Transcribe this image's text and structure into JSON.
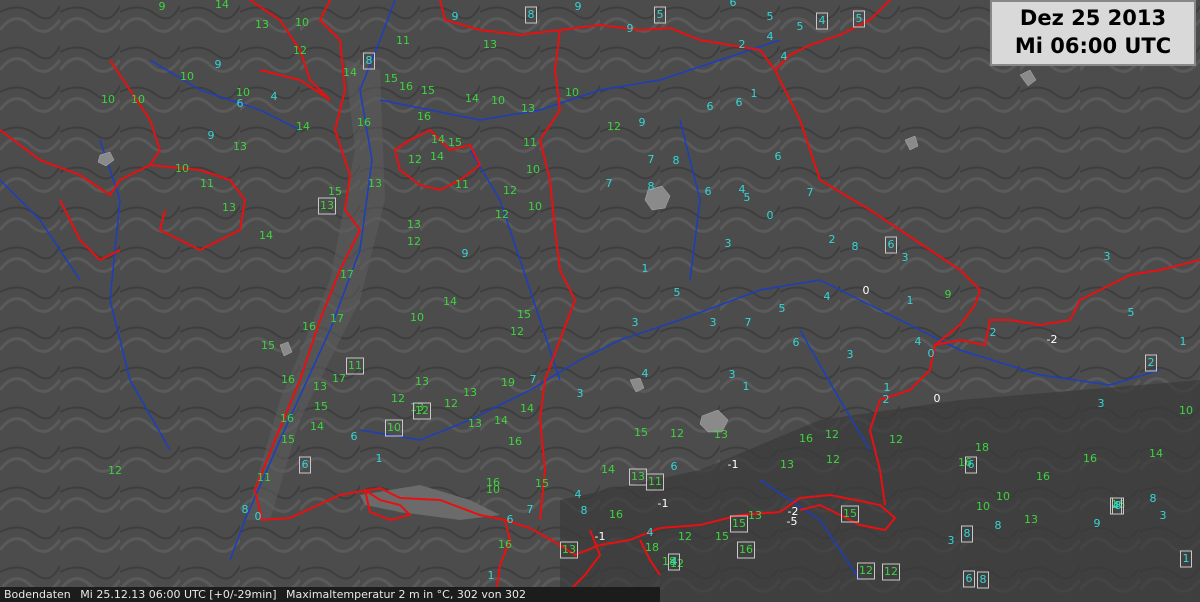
{
  "header": {
    "date": "Dez 25 2013",
    "time": "Mi 06:00 UTC"
  },
  "footer": {
    "source": "Bodendaten",
    "run": "Mi 25.12.13 06:00 UTC [+0/-29min]",
    "param": "Maximaltemperatur 2 m in °C, 302 von 302"
  },
  "colors": {
    "background": "#4a4a4a",
    "border": "#e81010",
    "river": "#1a3fbf",
    "warm": "#3fd43f",
    "mild": "#35d6d6",
    "cold": "#ffffff",
    "box": "#c8c8c8"
  },
  "stations": [
    {
      "t": "9",
      "c": "w"
    },
    {
      "t": "14",
      "c": "w"
    },
    {
      "t": "13",
      "c": "w"
    },
    {
      "t": "9",
      "c": "m"
    },
    {
      "t": "10",
      "c": "w"
    },
    {
      "t": "9",
      "c": "m"
    },
    {
      "t": "9",
      "c": "m"
    },
    {
      "t": "5",
      "c": "m"
    },
    {
      "t": "6",
      "c": "m"
    },
    {
      "t": "5",
      "c": "m"
    },
    {
      "t": "12",
      "c": "w"
    },
    {
      "t": "14",
      "c": "w"
    },
    {
      "t": "11",
      "c": "w"
    },
    {
      "t": "13",
      "c": "w"
    },
    {
      "t": "9",
      "c": "m"
    },
    {
      "t": "10",
      "c": "w"
    },
    {
      "t": "10",
      "c": "w"
    },
    {
      "t": "6",
      "c": "m"
    },
    {
      "t": "4",
      "c": "m"
    },
    {
      "t": "2",
      "c": "m"
    },
    {
      "t": "10",
      "c": "w"
    },
    {
      "t": "10",
      "c": "w"
    },
    {
      "t": "14",
      "c": "w"
    },
    {
      "t": "15",
      "c": "w"
    },
    {
      "t": "16",
      "c": "w"
    },
    {
      "t": "15",
      "c": "w"
    },
    {
      "t": "14",
      "c": "w"
    },
    {
      "t": "10",
      "c": "w"
    },
    {
      "t": "13",
      "c": "w"
    },
    {
      "t": "10",
      "c": "w"
    },
    {
      "t": "6",
      "c": "m"
    },
    {
      "t": "6",
      "c": "m"
    },
    {
      "t": "1",
      "c": "m"
    },
    {
      "t": "16",
      "c": "w"
    },
    {
      "t": "16",
      "c": "w"
    },
    {
      "t": "13",
      "c": "w"
    },
    {
      "t": "11",
      "c": "w"
    },
    {
      "t": "9",
      "c": "m"
    },
    {
      "t": "10",
      "c": "w"
    },
    {
      "t": "4",
      "c": "m"
    },
    {
      "t": "4",
      "c": "m"
    },
    {
      "t": "14",
      "c": "w"
    },
    {
      "t": "15",
      "c": "w"
    },
    {
      "t": "14",
      "c": "w"
    },
    {
      "t": "12",
      "c": "w"
    },
    {
      "t": "11",
      "c": "w"
    },
    {
      "t": "10",
      "c": "w"
    },
    {
      "t": "12",
      "c": "w"
    },
    {
      "t": "9",
      "c": "m"
    },
    {
      "t": "6",
      "c": "m"
    },
    {
      "t": "8",
      "c": "m"
    },
    {
      "t": "6",
      "c": "m"
    },
    {
      "t": "4",
      "c": "m"
    },
    {
      "t": "7",
      "c": "m"
    },
    {
      "t": "0",
      "c": "m"
    },
    {
      "t": "15",
      "c": "w"
    },
    {
      "t": "13",
      "c": "w"
    },
    {
      "t": "11",
      "c": "w"
    },
    {
      "t": "12",
      "c": "w"
    },
    {
      "t": "10",
      "c": "w"
    },
    {
      "t": "7",
      "c": "m"
    },
    {
      "t": "7",
      "c": "m"
    },
    {
      "t": "8",
      "c": "m"
    },
    {
      "t": "5",
      "c": "m"
    },
    {
      "t": "3",
      "c": "m"
    },
    {
      "t": "2",
      "c": "m"
    },
    {
      "t": "8",
      "c": "m"
    },
    {
      "t": "3",
      "c": "m"
    },
    {
      "t": "3",
      "c": "m"
    },
    {
      "t": "13",
      "c": "w"
    },
    {
      "t": "14",
      "c": "w"
    },
    {
      "t": "17",
      "c": "w"
    },
    {
      "t": "13",
      "c": "w"
    },
    {
      "t": "12",
      "c": "w"
    },
    {
      "t": "12",
      "c": "w"
    },
    {
      "t": "9",
      "c": "m"
    },
    {
      "t": "1",
      "c": "m"
    },
    {
      "t": "5",
      "c": "m"
    },
    {
      "t": "4",
      "c": "m"
    },
    {
      "t": "5",
      "c": "m"
    },
    {
      "t": "0",
      "c": "c"
    },
    {
      "t": "1",
      "c": "m"
    },
    {
      "t": "9",
      "c": "w"
    },
    {
      "t": "2",
      "c": "m"
    },
    {
      "t": "5",
      "c": "m"
    },
    {
      "t": "16",
      "c": "w"
    },
    {
      "t": "17",
      "c": "w"
    },
    {
      "t": "10",
      "c": "w"
    },
    {
      "t": "14",
      "c": "w"
    },
    {
      "t": "15",
      "c": "w"
    },
    {
      "t": "12",
      "c": "w"
    },
    {
      "t": "3",
      "c": "m"
    },
    {
      "t": "3",
      "c": "m"
    },
    {
      "t": "7",
      "c": "m"
    },
    {
      "t": "6",
      "c": "m"
    },
    {
      "t": "3",
      "c": "m"
    },
    {
      "t": "4",
      "c": "m"
    },
    {
      "t": "0",
      "c": "m"
    },
    {
      "t": "-2",
      "c": "c"
    },
    {
      "t": "1",
      "c": "m"
    },
    {
      "t": "15",
      "c": "w"
    },
    {
      "t": "16",
      "c": "w"
    },
    {
      "t": "15",
      "c": "w"
    },
    {
      "t": "13",
      "c": "w"
    },
    {
      "t": "19",
      "c": "w"
    },
    {
      "t": "7",
      "c": "m"
    },
    {
      "t": "3",
      "c": "m"
    },
    {
      "t": "4",
      "c": "m"
    },
    {
      "t": "3",
      "c": "m"
    },
    {
      "t": "1",
      "c": "m"
    },
    {
      "t": "2",
      "c": "m"
    },
    {
      "t": "0",
      "c": "c"
    },
    {
      "t": "1",
      "c": "m"
    },
    {
      "t": "3",
      "c": "m"
    },
    {
      "t": "10",
      "c": "w"
    },
    {
      "t": "16",
      "c": "w"
    },
    {
      "t": "15",
      "c": "w"
    },
    {
      "t": "14",
      "c": "w"
    },
    {
      "t": "6",
      "c": "m"
    },
    {
      "t": "1",
      "c": "m"
    },
    {
      "t": "13",
      "c": "w"
    },
    {
      "t": "12",
      "c": "w"
    },
    {
      "t": "13",
      "c": "w"
    },
    {
      "t": "12",
      "c": "w"
    },
    {
      "t": "13",
      "c": "w"
    },
    {
      "t": "16",
      "c": "w"
    },
    {
      "t": "12",
      "c": "w"
    },
    {
      "t": "15",
      "c": "w"
    },
    {
      "t": "13",
      "c": "w"
    },
    {
      "t": "12",
      "c": "w"
    },
    {
      "t": "16",
      "c": "w"
    },
    {
      "t": "17",
      "c": "w"
    },
    {
      "t": "13",
      "c": "w"
    },
    {
      "t": "14",
      "c": "w"
    },
    {
      "t": "14",
      "c": "w"
    },
    {
      "t": "11",
      "c": "w"
    },
    {
      "t": "16",
      "c": "w"
    },
    {
      "t": "15",
      "c": "w"
    },
    {
      "t": "14",
      "c": "w"
    },
    {
      "t": "6",
      "c": "m"
    },
    {
      "t": "-1",
      "c": "c"
    },
    {
      "t": "13",
      "c": "w"
    },
    {
      "t": "12",
      "c": "w"
    },
    {
      "t": "12",
      "c": "w"
    },
    {
      "t": "16",
      "c": "w"
    },
    {
      "t": "18",
      "c": "w"
    },
    {
      "t": "16",
      "c": "w"
    },
    {
      "t": "16",
      "c": "w"
    },
    {
      "t": "14",
      "c": "w"
    },
    {
      "t": "12",
      "c": "w"
    },
    {
      "t": "10",
      "c": "w"
    },
    {
      "t": "6",
      "c": "m"
    },
    {
      "t": "4",
      "c": "m"
    },
    {
      "t": "4",
      "c": "m"
    },
    {
      "t": "-1",
      "c": "c"
    },
    {
      "t": "16",
      "c": "w"
    },
    {
      "t": "18",
      "c": "w"
    },
    {
      "t": "13",
      "c": "w"
    },
    {
      "t": "-5",
      "c": "c"
    },
    {
      "t": "10",
      "c": "w"
    },
    {
      "t": "13",
      "c": "w"
    },
    {
      "t": "16",
      "c": "w"
    },
    {
      "t": "8",
      "c": "m"
    },
    {
      "t": "10",
      "c": "w"
    },
    {
      "t": "3",
      "c": "m"
    },
    {
      "t": "8",
      "c": "m"
    },
    {
      "t": "0",
      "c": "m"
    },
    {
      "t": "7",
      "c": "m"
    },
    {
      "t": "18",
      "c": "w"
    },
    {
      "t": "15",
      "c": "w"
    },
    {
      "t": "8",
      "c": "m"
    },
    {
      "t": "-2",
      "c": "c"
    },
    {
      "t": "12",
      "c": "w"
    },
    {
      "t": "12",
      "c": "w"
    },
    {
      "t": "-1",
      "c": "c"
    },
    {
      "t": "3",
      "c": "m"
    },
    {
      "t": "8",
      "c": "m"
    },
    {
      "t": "9",
      "c": "m"
    },
    {
      "t": "1",
      "c": "m"
    },
    {
      "t": "16",
      "c": "w"
    }
  ],
  "boxed": [
    {
      "t": "8",
      "c": "m"
    },
    {
      "t": "5",
      "c": "m"
    },
    {
      "t": "4",
      "c": "m"
    },
    {
      "t": "5",
      "c": "m"
    },
    {
      "t": "8",
      "c": "m"
    },
    {
      "t": "13",
      "c": "w"
    },
    {
      "t": "6",
      "c": "m"
    },
    {
      "t": "11",
      "c": "w"
    },
    {
      "t": "10",
      "c": "w"
    },
    {
      "t": "12",
      "c": "w"
    },
    {
      "t": "6",
      "c": "m"
    },
    {
      "t": "13",
      "c": "w"
    },
    {
      "t": "11",
      "c": "w"
    },
    {
      "t": "2",
      "c": "m"
    },
    {
      "t": "6",
      "c": "m"
    },
    {
      "t": "15",
      "c": "w"
    },
    {
      "t": "13",
      "c": "w"
    },
    {
      "t": "16",
      "c": "w"
    },
    {
      "t": "15",
      "c": "w"
    },
    {
      "t": "8",
      "c": "m"
    },
    {
      "t": "12",
      "c": "w"
    },
    {
      "t": "12",
      "c": "w"
    },
    {
      "t": "4",
      "c": "m"
    },
    {
      "t": "8",
      "c": "m"
    },
    {
      "t": "8",
      "c": "m"
    },
    {
      "t": "1",
      "c": "m"
    },
    {
      "t": "4",
      "c": "m"
    },
    {
      "t": "6",
      "c": "m"
    }
  ]
}
